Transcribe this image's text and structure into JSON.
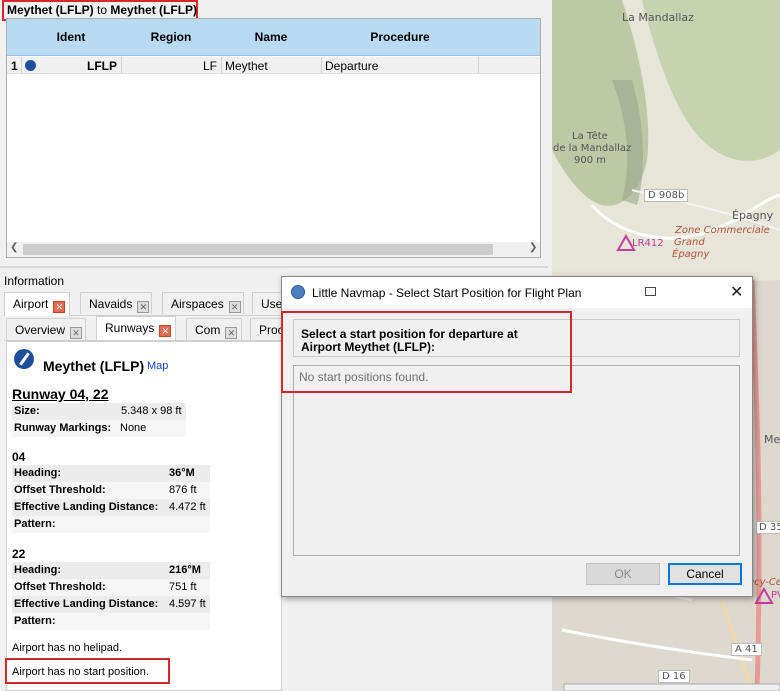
{
  "flight_plan": {
    "title_from": "Meythet (LFLP)",
    "title_to_word": "to",
    "title_to": "Meythet (LFLP)",
    "columns": [
      "Ident",
      "Region",
      "Name",
      "Procedure"
    ],
    "rows": [
      {
        "index": "1",
        "ident": "LFLP",
        "region": "LF",
        "name": "Meythet",
        "procedure": "Departure"
      }
    ]
  },
  "info": {
    "label": "Information",
    "main_tabs": [
      {
        "label": "Airport"
      },
      {
        "label": "Navaids"
      },
      {
        "label": "Airspaces"
      },
      {
        "label": "User"
      }
    ],
    "sub_tabs": [
      {
        "label": "Overview"
      },
      {
        "label": "Runways"
      },
      {
        "label": "Com"
      },
      {
        "label": "Proc"
      }
    ],
    "airport_name": "Meythet (LFLP)",
    "map_link": "Map",
    "runway_title": "Runway 04, 22",
    "size_label": "Size:",
    "size_value": "5.348 x 98 ft",
    "markings_label": "Runway Markings:",
    "markings_value": "None",
    "ends": [
      {
        "id": "04",
        "heading_label": "Heading:",
        "heading": "36°M",
        "offset_label": "Offset Threshold:",
        "offset": "876 ft",
        "landing_label": "Effective Landing Distance:",
        "landing": "4.472 ft",
        "pattern_label": "Pattern:"
      },
      {
        "id": "22",
        "heading_label": "Heading:",
        "heading": "216°M",
        "offset_label": "Offset Threshold:",
        "offset": "751 ft",
        "landing_label": "Effective Landing Distance:",
        "landing": "4.597 ft",
        "pattern_label": "Pattern:"
      }
    ],
    "no_helipad": "Airport has no helipad.",
    "no_start": "Airport has no start position."
  },
  "dialog": {
    "title": "Little Navmap - Select Start Position for Flight Plan",
    "heading_line1": "Select a start position for departure at",
    "heading_line2": "Airport Meythet (LFLP):",
    "empty_message": "No start positions found.",
    "ok_label": "OK",
    "cancel_label": "Cancel"
  },
  "map": {
    "labels": [
      "La Mandallaz",
      "La Tête",
      "de la Mandallaz",
      "900 m",
      "D 908b",
      "Épagny",
      "LR412",
      "Zone Commerciale",
      "Grand",
      "Épagny",
      "Me",
      "D 35",
      "ecy-Ce",
      "PVP",
      "A 41",
      "D 16"
    ]
  },
  "colors": {
    "highlight_red": "#d62828",
    "table_header": "#b9daf3",
    "map_link": "#1a3fc4"
  }
}
